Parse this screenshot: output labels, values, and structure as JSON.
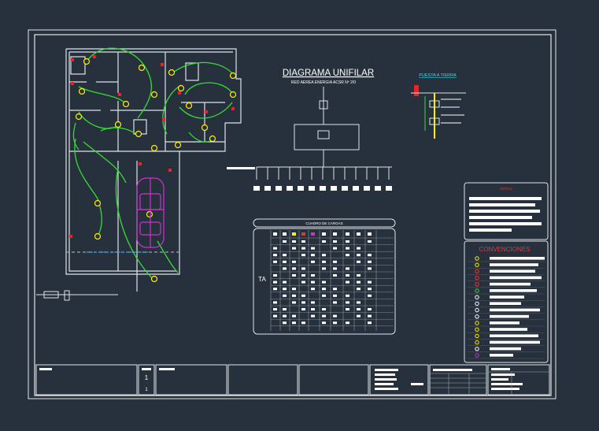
{
  "diagram": {
    "title": "DIAGRAMA UNIFILAR",
    "subtitle": "RED AEREA ENERGIA ACSR Nº 2/0",
    "grounding_title": "PUESTA A TIERRA",
    "load_table_title": "CUADRO DE CARGAS",
    "load_table_row_label": "TA",
    "notes_title": "NOTAS",
    "conventions_title": "CONVENCIONES",
    "title_block_digits": [
      "1",
      "1"
    ]
  },
  "colors": {
    "background": "#27313d",
    "sheet_border": "#ffffff",
    "wiring": "#33dd33",
    "fixture": "#ffee00",
    "car": "#cc33cc",
    "accent_red": "#ee2222",
    "grounding_label": "#33ddee",
    "dimension": "#33aaee"
  }
}
